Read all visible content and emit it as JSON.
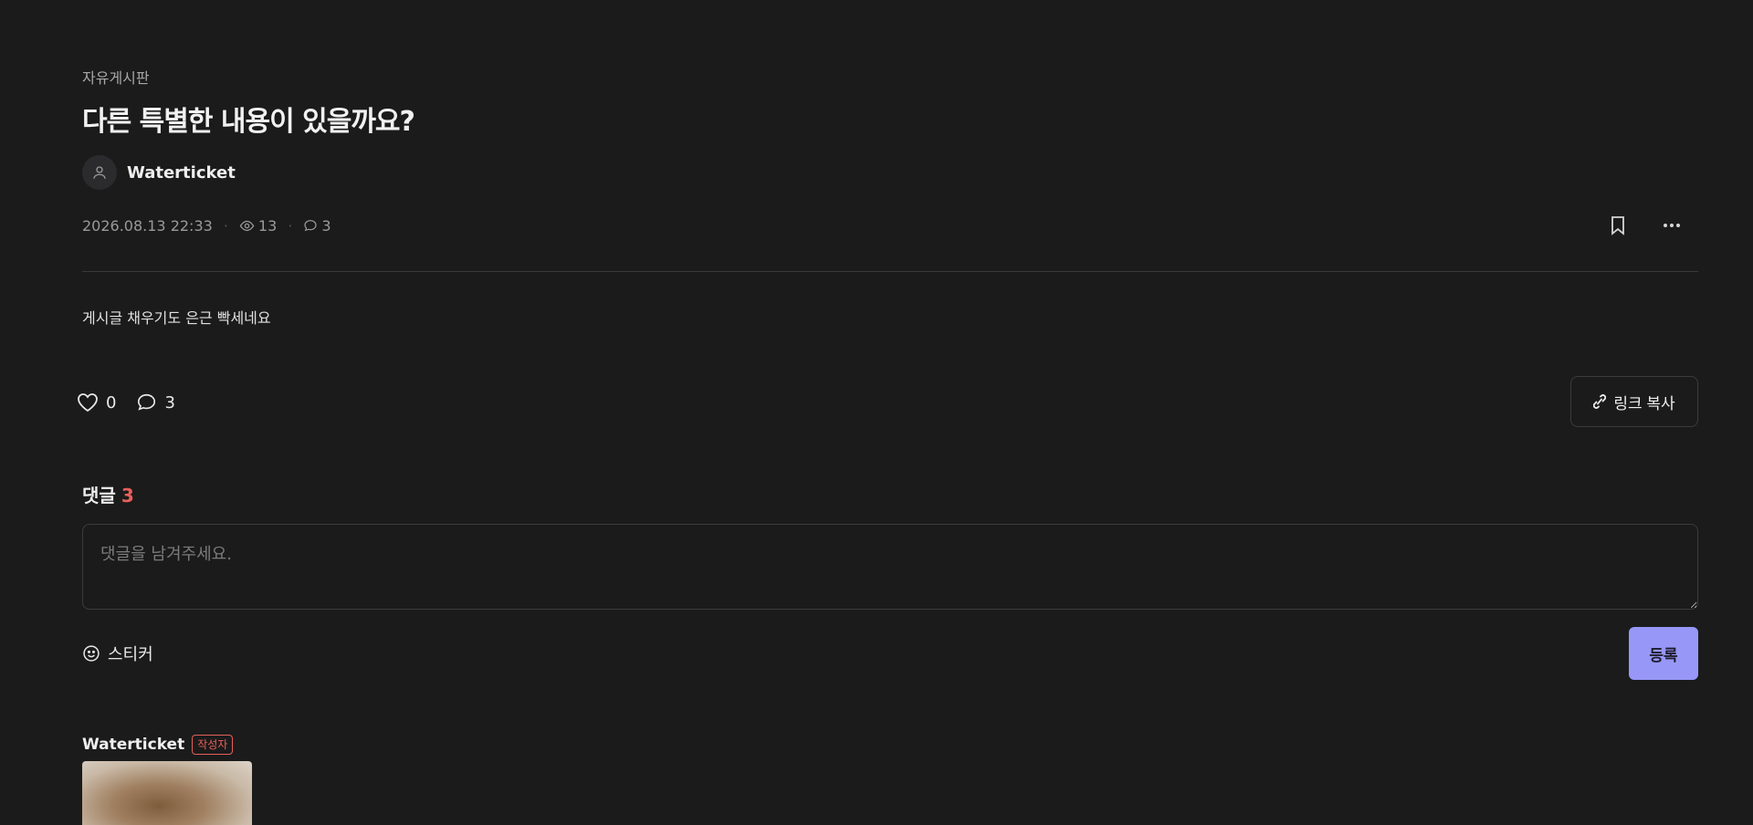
{
  "post": {
    "board": "자유게시판",
    "title": "다른 특별한 내용이 있을까요?",
    "author": "Waterticket",
    "date": "2026.08.13 22:33",
    "views": "13",
    "comment_count": "3",
    "body": "게시글 채우기도 은근 빡세네요",
    "likes": "0",
    "comments": "3"
  },
  "icons": {
    "avatar": "user-icon",
    "views": "eye-icon",
    "comments": "speech-bubble-icon",
    "bookmark": "bookmark-icon",
    "more": "more-horizontal-icon",
    "like": "heart-icon",
    "link": "link-icon",
    "sticker": "smile-icon"
  },
  "actions": {
    "link_copy": "링크 복사"
  },
  "comments_section": {
    "heading": "댓글",
    "count": "3",
    "placeholder": "댓글을 남겨주세요.",
    "sticker_label": "스티커",
    "submit_label": "등록"
  },
  "comment_list": [
    {
      "author": "Waterticket",
      "badge": "작성자"
    }
  ],
  "colors": {
    "background": "#1b1b1b",
    "accent": "#9797f7",
    "badge": "#e5605a"
  }
}
